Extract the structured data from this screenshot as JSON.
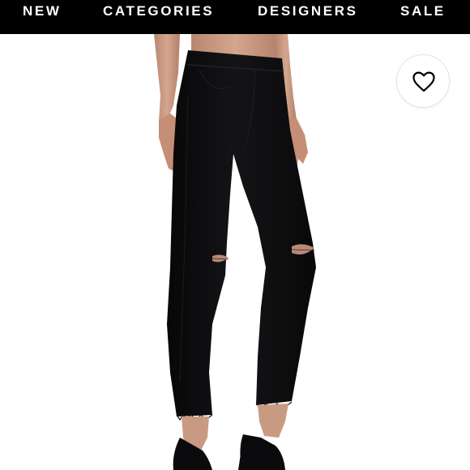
{
  "nav": {
    "items": [
      {
        "label": "NEW"
      },
      {
        "label": "CATEGORIES"
      },
      {
        "label": "DESIGNERS"
      },
      {
        "label": "SALE"
      }
    ]
  },
  "product": {
    "image_icon": "heart-icon",
    "jeans_color": "#0e0e10",
    "skin_color": "#c99a82"
  },
  "colors": {
    "nav_background": "#000000",
    "nav_text": "#ffffff",
    "page_background": "#ffffff"
  }
}
